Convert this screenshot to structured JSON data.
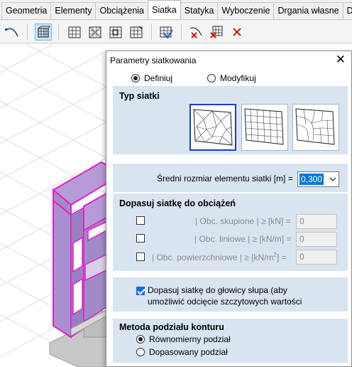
{
  "tabs": [
    {
      "label": "Geometria"
    },
    {
      "label": "Elementy"
    },
    {
      "label": "Obciążenia"
    },
    {
      "label": "Siatka"
    },
    {
      "label": "Statyka"
    },
    {
      "label": "Wyboczenie"
    },
    {
      "label": "Drgania własne"
    },
    {
      "label": "Dyna"
    }
  ],
  "active_tab": "Siatka",
  "colors": {
    "accent": "#0078d7",
    "highlight_edges": "#e020c8",
    "section_bg": "#d9e4f1"
  },
  "dialog": {
    "title": "Parametry siatkowania",
    "close": "✕",
    "mode": {
      "define_label": "Definiuj",
      "modify_label": "Modyfikuj",
      "selected": "define"
    },
    "mesh_type": {
      "title": "Typ siatki",
      "options": [
        "triangular",
        "quadrilateral",
        "mixed"
      ],
      "selected_index": 0
    },
    "element_size": {
      "label": "Średni rozmiar elementu siatki [m] =",
      "value": "0,300"
    },
    "load_fit": {
      "title": "Dopasuj siatkę do obciążeń",
      "rows": [
        {
          "label": "| Obc. skupione | ≥ [kN] =",
          "value": "0",
          "checked": false,
          "disabled": true
        },
        {
          "label": "| Obc. liniowe | ≥ [kN/m] =",
          "value": "0",
          "checked": false,
          "disabled": true
        },
        {
          "label": "| Obc. powierzchniowe | ≥ [kN/m",
          "superscript": "2",
          "label_tail": "] =",
          "value": "0",
          "checked": false,
          "disabled": true
        }
      ]
    },
    "column_head": {
      "line1": "Dopasuj siatkę do głowicy słupa (aby",
      "line2": "umożliwić odcięcie szczytowych wartości",
      "checked": true
    },
    "contour": {
      "title": "Metoda podziału konturu",
      "options": [
        {
          "label": "Równomierny podział",
          "selected": true
        },
        {
          "label": "Dopasowany podział",
          "selected": false
        }
      ]
    }
  }
}
